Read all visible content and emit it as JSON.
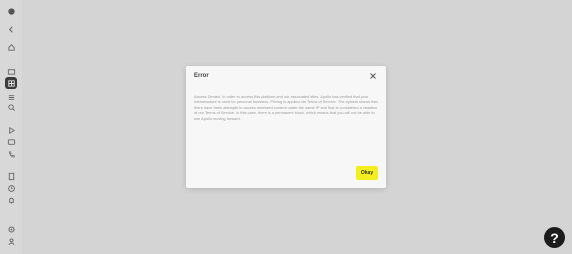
{
  "sidebar": {
    "icons": [
      "logo-icon",
      "back-icon",
      "home-icon",
      "folder-icon",
      "grid-icon",
      "list-icon",
      "search-icon",
      "play-icon",
      "chat-icon",
      "phone-icon",
      "document-icon",
      "clock-icon",
      "bell-icon",
      "settings-icon",
      "user-icon"
    ]
  },
  "modal": {
    "title": "Error",
    "close_icon": "close-icon",
    "body": "Access Denied. In order to access this platform and our associated sites, Apollo has verified that your infrastructure is used for personal business. Pricing is applied via Terms of Service. The system shows that there have been attempts to access restricted content under the same IP and that is considered a violation of our Terms of Service. In this case, there is a permanent block, which means that you will not be able to use Apollo moving forward.",
    "ok_label": "Okay"
  },
  "help": {
    "label": "?"
  },
  "colors": {
    "accent": "#f4ee1e",
    "fab": "#1c1c1c",
    "backdrop": "#d4d4d4"
  }
}
